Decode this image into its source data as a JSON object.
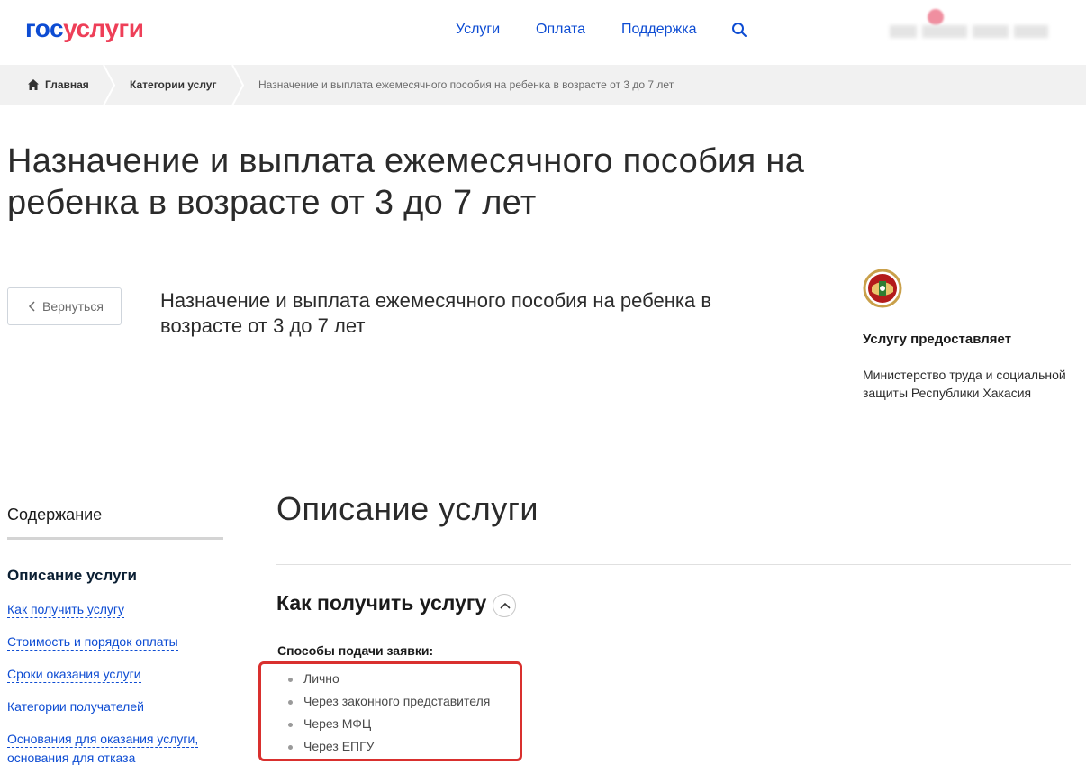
{
  "header": {
    "logo": {
      "part1": "гос",
      "part2": "услуги"
    },
    "nav": [
      {
        "label": "Услуги"
      },
      {
        "label": "Оплата"
      },
      {
        "label": "Поддержка"
      }
    ]
  },
  "breadcrumb": {
    "home": "Главная",
    "category": "Категории услуг",
    "current": "Назначение и выплата ежемесячного пособия на ребенка в возрасте от 3 до 7 лет"
  },
  "page": {
    "title": "Назначение и выплата ежемесячного пособия на ребенка в возрасте от 3 до 7 лет",
    "back_label": "Вернуться",
    "service_title": "Назначение и выплата ежемесячного пособия на ребенка в возрасте от 3 до 7 лет"
  },
  "provider": {
    "heading": "Услугу предоставляет",
    "name": "Министерство труда и социальной защиты Республики Хакасия"
  },
  "toc": {
    "title": "Содержание",
    "active": "Описание услуги",
    "links": [
      {
        "label": "Как получить услугу"
      },
      {
        "label": "Стоимость и порядок оплаты"
      },
      {
        "label": "Сроки оказания услуги"
      },
      {
        "label": "Категории получателей"
      },
      {
        "label": "Основания для оказания услуги,"
      },
      {
        "label": "основания для отказа"
      }
    ]
  },
  "main": {
    "section_title": "Описание услуги",
    "subsection_title": "Как получить услугу",
    "methods_label": "Способы подачи заявки:",
    "methods": [
      {
        "label": "Лично"
      },
      {
        "label": "Через законного представителя"
      },
      {
        "label": "Через МФЦ"
      },
      {
        "label": "Через ЕПГУ"
      }
    ]
  },
  "colors": {
    "brand_blue": "#0d4cd3",
    "brand_red": "#ee3f58",
    "highlight_red": "#d9302e",
    "breadcrumb_bg": "#f1f1f1"
  }
}
